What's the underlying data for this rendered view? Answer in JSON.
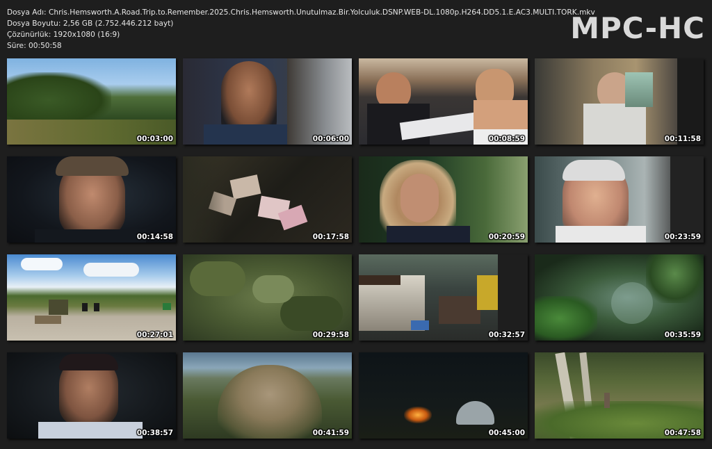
{
  "file_info": {
    "name": "Dosya Adı: Chris.Hemsworth.A.Road.Trip.to.Remember.2025.Chris.Hemsworth.Unutulmaz.Bir.Yolculuk.DSNP.WEB-DL.1080p.H264.DD5.1.E.AC3.MULTI.TORK.mkv",
    "size": "Dosya Boyutu: 2,56 GB (2.752.446.212 bayt)",
    "resolution": "Çözünürlük: 1920x1080 (16:9)",
    "duration": "Süre: 00:50:58"
  },
  "logo": "MPC-HC",
  "thumbnails": [
    {
      "time": "00:03:00"
    },
    {
      "time": "00:06:00"
    },
    {
      "time": "00:08:59"
    },
    {
      "time": "00:11:58"
    },
    {
      "time": "00:14:58"
    },
    {
      "time": "00:17:58"
    },
    {
      "time": "00:20:59"
    },
    {
      "time": "00:23:59"
    },
    {
      "time": "00:27:01"
    },
    {
      "time": "00:29:58"
    },
    {
      "time": "00:32:57"
    },
    {
      "time": "00:35:59"
    },
    {
      "time": "00:38:57"
    },
    {
      "time": "00:41:59"
    },
    {
      "time": "00:45:00"
    },
    {
      "time": "00:47:58"
    }
  ]
}
